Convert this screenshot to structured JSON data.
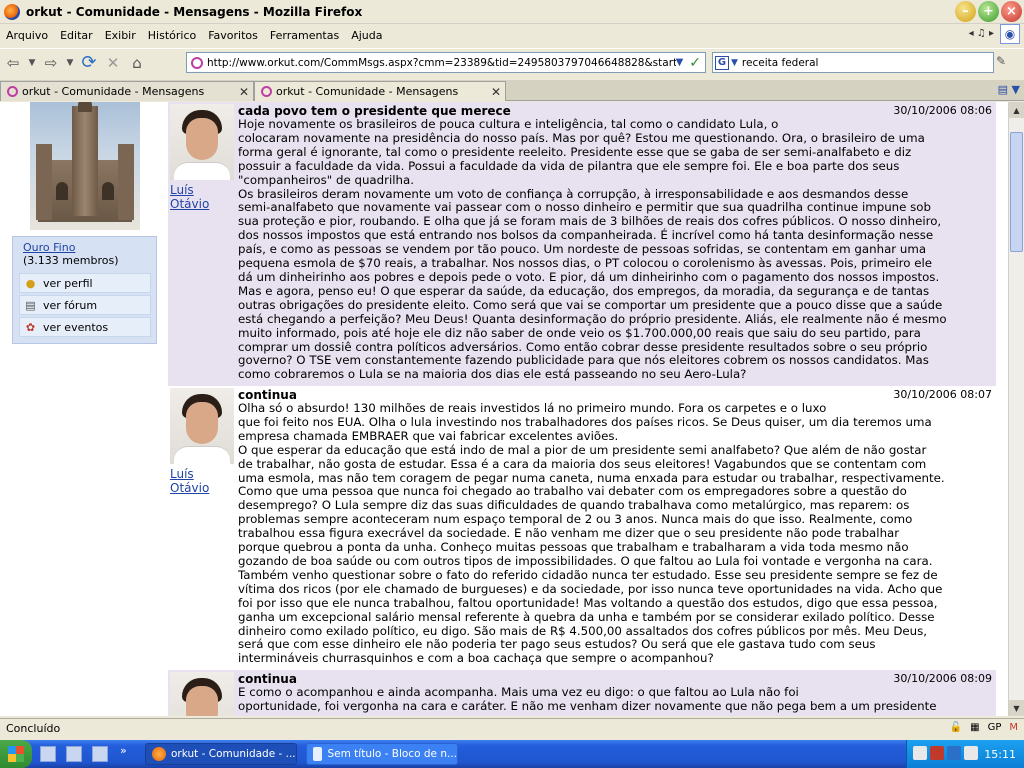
{
  "window": {
    "title": "orkut - Comunidade - Mensagens - Mozilla Firefox"
  },
  "menu": {
    "items": [
      "Arquivo",
      "Editar",
      "Exibir",
      "Histórico",
      "Favoritos",
      "Ferramentas",
      "Ajuda"
    ]
  },
  "navbar": {
    "url": "http://www.orkut.com/CommMsgs.aspx?cmm=23389&tid=2495803797046648828&start=1",
    "search_value": "receita federal",
    "search_engine_letter": "G"
  },
  "tabs": [
    {
      "label": "orkut - Comunidade - Mensagens"
    },
    {
      "label": "orkut - Comunidade - Mensagens"
    }
  ],
  "sidebar": {
    "community_name": "Ouro Fino",
    "members": "(3.133 membros)",
    "links": [
      {
        "label": "ver perfil",
        "icon": "person-icon"
      },
      {
        "label": "ver fórum",
        "icon": "forum-icon"
      },
      {
        "label": "ver eventos",
        "icon": "events-icon"
      }
    ]
  },
  "messages": [
    {
      "author": "Luís Otávio",
      "title": "cada povo tem o presidente que merece",
      "date": "30/10/2006 08:06",
      "body": "Hoje novamente os brasileiros de pouca cultura e inteligência, tal como o candidato Lula, o\ncolocaram novamente na presidência do nosso país. Mas por quê? Estou me questionando. Ora, o brasileiro de uma\nforma geral é ignorante, tal como o presidente reeleito. Presidente esse que se gaba de ser semi-analfabeto e diz\npossuir a faculdade da vida. Possui a faculdade da vida de pilantra que ele sempre foi. Ele e boa parte dos seus\n\"companheiros\" de quadrilha.\nOs brasileiros deram novamente um voto de confiança à corrupção, à irresponsabilidade e aos desmandos desse\nsemi-analfabeto que novamente vai passear com o nosso dinheiro e permitir que sua quadrilha continue impune sob\nsua proteção e pior, roubando. E olha que já se foram mais de 3 bilhões de reais dos cofres públicos. O nosso dinheiro,\ndos nossos impostos que está entrando nos bolsos da companheirada. É incrível como há tanta desinformação nesse\npaís, e como as pessoas se vendem por tão pouco. Um nordeste de pessoas sofridas, se contentam em ganhar uma\npequena esmola de $70 reais, a trabalhar. Nos nossos dias, o PT colocou o corolenismo às avessas. Pois, primeiro ele\ndá um dinheirinho aos pobres e depois pede o voto. E pior, dá um dinheirinho com o pagamento dos nossos impostos.\nMas e agora, penso eu! O que esperar da saúde, da educação, dos empregos, da moradia, da segurança e de tantas\noutras obrigações do presidente eleito. Como será que vai se comportar um presidente que a pouco disse que a saúde\nestá chegando a perfeição? Meu Deus! Quanta desinformação do próprio presidente. Aliás, ele realmente não é mesmo\nmuito informado, pois até hoje ele diz não saber de onde veio os $1.700.000,00 reais que saiu do seu partido, para\ncomprar um dossiê contra políticos adversários. Como então cobrar desse presidente resultados sobre o seu próprio\ngoverno? O TSE vem constantemente fazendo publicidade para que nós eleitores cobrem os nossos candidatos. Mas\ncomo cobraremos o Lula se na maioria dos dias ele está passeando no seu Aero-Lula?"
    },
    {
      "author": "Luís Otávio",
      "title": "continua",
      "date": "30/10/2006 08:07",
      "body": "Olha só o absurdo! 130 milhões de reais investidos lá no primeiro mundo. Fora os carpetes e o luxo\nque foi feito nos EUA. Olha o lula investindo nos trabalhadores dos países ricos. Se Deus quiser, um dia teremos uma\nempresa chamada EMBRAER que vai fabricar excelentes aviões.\nO que esperar da educação que está indo de mal a pior de um presidente semi analfabeto? Que além de não gostar\nde trabalhar, não gosta de estudar. Essa é a cara da maioria dos seus eleitores! Vagabundos que se contentam com\numa esmola, mas não tem coragem de pegar numa caneta, numa enxada para estudar ou trabalhar, respectivamente.\nComo que uma pessoa que nunca foi chegado ao trabalho vai debater com os empregadores sobre a questão do\ndesemprego? O Lula sempre diz das suas dificuldades de quando trabalhava como metalúrgico, mas reparem: os\nproblemas sempre aconteceram num espaço temporal de 2 ou 3 anos. Nunca mais do que isso. Realmente, como\ntrabalhou essa figura execrável da sociedade. E não venham me dizer que o seu presidente não pode trabalhar\nporque quebrou a ponta da unha. Conheço muitas pessoas que trabalham e trabalharam a vida toda mesmo não\ngozando de boa saúde ou com outros tipos de impossibilidades. O que faltou ao Lula foi vontade e vergonha na cara.\nTambém venho questionar sobre o fato do referido cidadão nunca ter estudado. Esse seu presidente sempre se fez de\nvítima dos ricos (por ele chamado de burgueses) e da sociedade, por isso nunca teve oportunidades na vida. Acho que\nfoi por isso que ele nunca trabalhou, faltou oportunidade! Mas voltando a questão dos estudos, digo que essa pessoa,\nganha um excepcional salário mensal referente à quebra da unha e também por se considerar exilado político. Desse\ndinheiro como exilado político, eu digo. São mais de R$ 4.500,00 assaltados dos cofres públicos por mês. Meu Deus,\nserá que com esse dinheiro ele não poderia ter pago seus estudos? Ou será que ele gastava tudo com seus\nintermináveis churrasquinhos e com a boa cachaça que sempre o acompanhou?"
    },
    {
      "author": "",
      "title": "continua",
      "date": "30/10/2006 08:09",
      "body": "E como o acompanhou e ainda acompanha. Mais uma vez eu digo: o que faltou ao Lula não foi\noportunidade, foi vergonha na cara e caráter. E não me venham dizer novamente que não pega bem a um presidente"
    }
  ],
  "status": {
    "text": "Concluído",
    "right_label": "GP"
  },
  "taskbar": {
    "tasks": [
      {
        "label": "orkut - Comunidade - ..."
      },
      {
        "label": "Sem título - Bloco de n..."
      }
    ],
    "clock": "15:11"
  }
}
